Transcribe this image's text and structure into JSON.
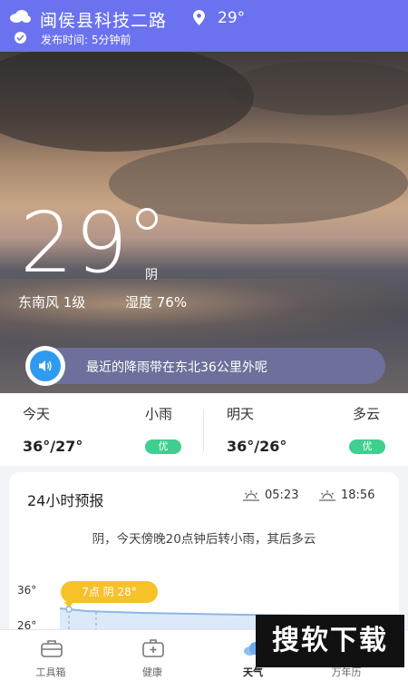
{
  "header": {
    "city": "闽侯县科技二路",
    "temperature": "29°",
    "publish_time": "发布时间:  5分钟前"
  },
  "hero": {
    "temperature": "29",
    "condition": "阴",
    "wind": "东南风  1级",
    "humidity": "湿度  76%"
  },
  "alert": {
    "text": "最近的降雨带在东北36公里外呢"
  },
  "today": {
    "label": "今天",
    "condition": "小雨",
    "temp_range": "36°/27°",
    "aqi": "优"
  },
  "tomorrow": {
    "label": "明天",
    "condition": "多云",
    "temp_range": "36°/26°",
    "aqi": "优"
  },
  "hourly": {
    "title": "24小时预报",
    "sunrise": "05:23",
    "sunset": "18:56",
    "description": "阴，今天傍晚20点钟后转小雨，其后多云",
    "y_max_label": "36°",
    "y_min_label": "26°",
    "bubble": "7点  阴  28°"
  },
  "nav": {
    "items": [
      {
        "label": "工具箱"
      },
      {
        "label": "健康"
      },
      {
        "label": "天气"
      },
      {
        "label": ""
      },
      {
        "label": "万年历"
      }
    ]
  },
  "watermark": "搜软下载",
  "colors": {
    "header_bg": "#6a72f0",
    "aqi_good": "#3fcf8e",
    "speaker_blue": "#2f9bf0",
    "bubble_yellow": "#f7c12a"
  }
}
